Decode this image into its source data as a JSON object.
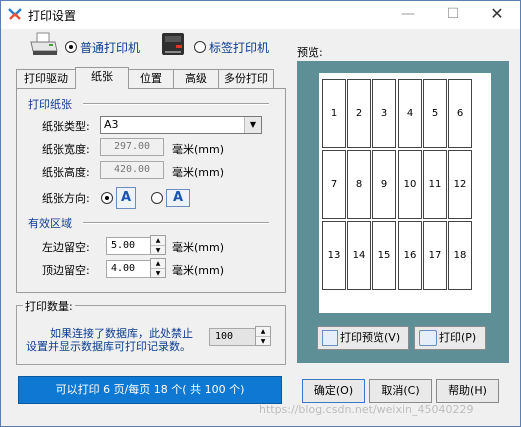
{
  "window": {
    "title": "打印设置",
    "minimize": "—",
    "maximize": "☐",
    "close": "✕"
  },
  "printer": {
    "normal_label": "普通打印机",
    "label_printer_label": "标签打印机",
    "selected": "normal"
  },
  "tabs": [
    {
      "label": "打印驱动"
    },
    {
      "label": "纸张"
    },
    {
      "label": "位置"
    },
    {
      "label": "高级"
    },
    {
      "label": "多份打印"
    }
  ],
  "active_tab": 1,
  "paper": {
    "section_label": "打印纸张",
    "type_label": "纸张类型:",
    "type_value": "A3",
    "width_label": "纸张宽度:",
    "width_value": "297.00",
    "height_label": "纸张高度:",
    "height_value": "420.00",
    "unit": "毫米(mm)",
    "orientation_label": "纸张方向:",
    "orientation_glyph": "A",
    "orientation_selected": "portrait"
  },
  "area": {
    "section_label": "有效区域",
    "left_label": "左边留空:",
    "left_value": "5.00",
    "top_label": "顶边留空:",
    "top_value": "4.00",
    "unit": "毫米(mm)"
  },
  "quantity": {
    "section_label": "打印数量:",
    "note_line1": "如果连接了数据库，此处禁止",
    "note_line2": "设置并显示数据库可打印记录数。",
    "value": "100"
  },
  "status": {
    "text": "可以打印 6 页/每页 18 个( 共 100 个)"
  },
  "preview": {
    "label": "预览:",
    "cells": [
      "1",
      "2",
      "3",
      "4",
      "5",
      "6",
      "7",
      "8",
      "9",
      "10",
      "11",
      "12",
      "13",
      "14",
      "15",
      "16",
      "17",
      "18"
    ],
    "columns": 6,
    "print_preview_button": "打印预览(V)",
    "print_button": "打印(P)"
  },
  "buttons": {
    "ok": "确定(O)",
    "cancel": "取消(C)",
    "help": "帮助(H)"
  },
  "watermark": "https://blog.csdn.net/weixin_45040229",
  "colors": {
    "accent": "#0e78d2",
    "preview_bg": "#5e8f96",
    "section_text": "#0b3d91"
  }
}
